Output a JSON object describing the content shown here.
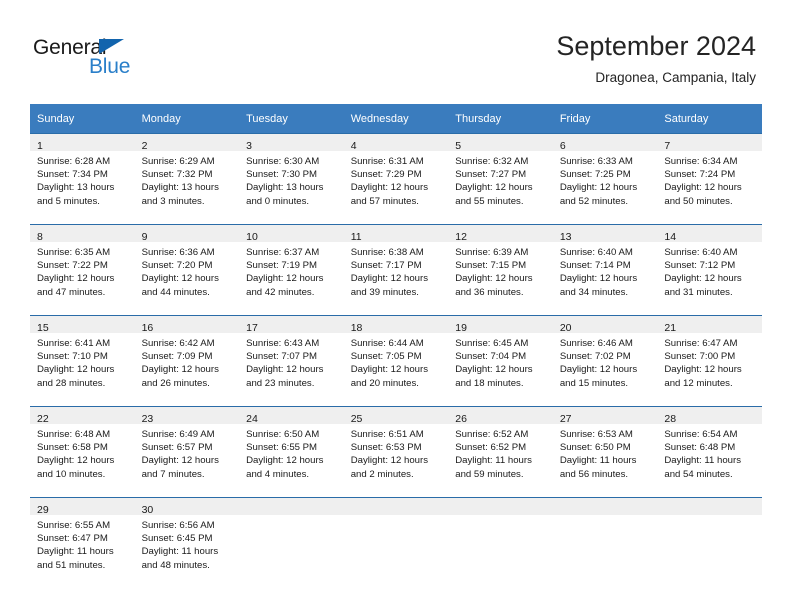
{
  "logo": {
    "primary_text": "General",
    "secondary_text": "Blue",
    "primary_color": "#1a1a1a",
    "secondary_color": "#2a7fc9",
    "triangle_color": "#1264ad"
  },
  "header": {
    "title": "September 2024",
    "subtitle": "Dragonea, Campania, Italy"
  },
  "colors": {
    "header_row_bg": "#3a7cbe",
    "header_row_text": "#ffffff",
    "daynum_band_bg": "#efefef",
    "row_divider": "#2a6ca8",
    "cell_bg": "#ffffff",
    "body_text": "#1a1a1a"
  },
  "weekday_headers": [
    "Sunday",
    "Monday",
    "Tuesday",
    "Wednesday",
    "Thursday",
    "Friday",
    "Saturday"
  ],
  "weeks": [
    [
      {
        "day": "1",
        "lines": [
          "Sunrise: 6:28 AM",
          "Sunset: 7:34 PM",
          "Daylight: 13 hours",
          "and 5 minutes."
        ]
      },
      {
        "day": "2",
        "lines": [
          "Sunrise: 6:29 AM",
          "Sunset: 7:32 PM",
          "Daylight: 13 hours",
          "and 3 minutes."
        ]
      },
      {
        "day": "3",
        "lines": [
          "Sunrise: 6:30 AM",
          "Sunset: 7:30 PM",
          "Daylight: 13 hours",
          "and 0 minutes."
        ]
      },
      {
        "day": "4",
        "lines": [
          "Sunrise: 6:31 AM",
          "Sunset: 7:29 PM",
          "Daylight: 12 hours",
          "and 57 minutes."
        ]
      },
      {
        "day": "5",
        "lines": [
          "Sunrise: 6:32 AM",
          "Sunset: 7:27 PM",
          "Daylight: 12 hours",
          "and 55 minutes."
        ]
      },
      {
        "day": "6",
        "lines": [
          "Sunrise: 6:33 AM",
          "Sunset: 7:25 PM",
          "Daylight: 12 hours",
          "and 52 minutes."
        ]
      },
      {
        "day": "7",
        "lines": [
          "Sunrise: 6:34 AM",
          "Sunset: 7:24 PM",
          "Daylight: 12 hours",
          "and 50 minutes."
        ]
      }
    ],
    [
      {
        "day": "8",
        "lines": [
          "Sunrise: 6:35 AM",
          "Sunset: 7:22 PM",
          "Daylight: 12 hours",
          "and 47 minutes."
        ]
      },
      {
        "day": "9",
        "lines": [
          "Sunrise: 6:36 AM",
          "Sunset: 7:20 PM",
          "Daylight: 12 hours",
          "and 44 minutes."
        ]
      },
      {
        "day": "10",
        "lines": [
          "Sunrise: 6:37 AM",
          "Sunset: 7:19 PM",
          "Daylight: 12 hours",
          "and 42 minutes."
        ]
      },
      {
        "day": "11",
        "lines": [
          "Sunrise: 6:38 AM",
          "Sunset: 7:17 PM",
          "Daylight: 12 hours",
          "and 39 minutes."
        ]
      },
      {
        "day": "12",
        "lines": [
          "Sunrise: 6:39 AM",
          "Sunset: 7:15 PM",
          "Daylight: 12 hours",
          "and 36 minutes."
        ]
      },
      {
        "day": "13",
        "lines": [
          "Sunrise: 6:40 AM",
          "Sunset: 7:14 PM",
          "Daylight: 12 hours",
          "and 34 minutes."
        ]
      },
      {
        "day": "14",
        "lines": [
          "Sunrise: 6:40 AM",
          "Sunset: 7:12 PM",
          "Daylight: 12 hours",
          "and 31 minutes."
        ]
      }
    ],
    [
      {
        "day": "15",
        "lines": [
          "Sunrise: 6:41 AM",
          "Sunset: 7:10 PM",
          "Daylight: 12 hours",
          "and 28 minutes."
        ]
      },
      {
        "day": "16",
        "lines": [
          "Sunrise: 6:42 AM",
          "Sunset: 7:09 PM",
          "Daylight: 12 hours",
          "and 26 minutes."
        ]
      },
      {
        "day": "17",
        "lines": [
          "Sunrise: 6:43 AM",
          "Sunset: 7:07 PM",
          "Daylight: 12 hours",
          "and 23 minutes."
        ]
      },
      {
        "day": "18",
        "lines": [
          "Sunrise: 6:44 AM",
          "Sunset: 7:05 PM",
          "Daylight: 12 hours",
          "and 20 minutes."
        ]
      },
      {
        "day": "19",
        "lines": [
          "Sunrise: 6:45 AM",
          "Sunset: 7:04 PM",
          "Daylight: 12 hours",
          "and 18 minutes."
        ]
      },
      {
        "day": "20",
        "lines": [
          "Sunrise: 6:46 AM",
          "Sunset: 7:02 PM",
          "Daylight: 12 hours",
          "and 15 minutes."
        ]
      },
      {
        "day": "21",
        "lines": [
          "Sunrise: 6:47 AM",
          "Sunset: 7:00 PM",
          "Daylight: 12 hours",
          "and 12 minutes."
        ]
      }
    ],
    [
      {
        "day": "22",
        "lines": [
          "Sunrise: 6:48 AM",
          "Sunset: 6:58 PM",
          "Daylight: 12 hours",
          "and 10 minutes."
        ]
      },
      {
        "day": "23",
        "lines": [
          "Sunrise: 6:49 AM",
          "Sunset: 6:57 PM",
          "Daylight: 12 hours",
          "and 7 minutes."
        ]
      },
      {
        "day": "24",
        "lines": [
          "Sunrise: 6:50 AM",
          "Sunset: 6:55 PM",
          "Daylight: 12 hours",
          "and 4 minutes."
        ]
      },
      {
        "day": "25",
        "lines": [
          "Sunrise: 6:51 AM",
          "Sunset: 6:53 PM",
          "Daylight: 12 hours",
          "and 2 minutes."
        ]
      },
      {
        "day": "26",
        "lines": [
          "Sunrise: 6:52 AM",
          "Sunset: 6:52 PM",
          "Daylight: 11 hours",
          "and 59 minutes."
        ]
      },
      {
        "day": "27",
        "lines": [
          "Sunrise: 6:53 AM",
          "Sunset: 6:50 PM",
          "Daylight: 11 hours",
          "and 56 minutes."
        ]
      },
      {
        "day": "28",
        "lines": [
          "Sunrise: 6:54 AM",
          "Sunset: 6:48 PM",
          "Daylight: 11 hours",
          "and 54 minutes."
        ]
      }
    ],
    [
      {
        "day": "29",
        "lines": [
          "Sunrise: 6:55 AM",
          "Sunset: 6:47 PM",
          "Daylight: 11 hours",
          "and 51 minutes."
        ]
      },
      {
        "day": "30",
        "lines": [
          "Sunrise: 6:56 AM",
          "Sunset: 6:45 PM",
          "Daylight: 11 hours",
          "and 48 minutes."
        ]
      },
      {
        "day": "",
        "lines": []
      },
      {
        "day": "",
        "lines": []
      },
      {
        "day": "",
        "lines": []
      },
      {
        "day": "",
        "lines": []
      },
      {
        "day": "",
        "lines": []
      }
    ]
  ]
}
